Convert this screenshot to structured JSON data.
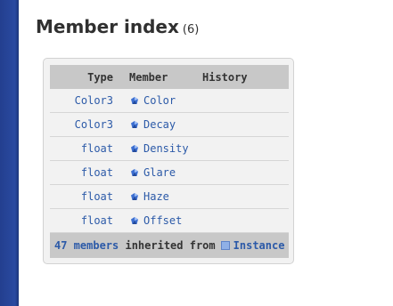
{
  "heading": {
    "title": "Member index",
    "count": "(6)"
  },
  "table": {
    "headers": {
      "type": "Type",
      "member": "Member",
      "history": "History"
    },
    "rows": [
      {
        "type": "Color3",
        "member": "Color"
      },
      {
        "type": "Color3",
        "member": "Decay"
      },
      {
        "type": "float",
        "member": "Density"
      },
      {
        "type": "float",
        "member": "Glare"
      },
      {
        "type": "float",
        "member": "Haze"
      },
      {
        "type": "float",
        "member": "Offset"
      }
    ],
    "footer": {
      "members_link": "47 members",
      "inherited_text": "inherited from",
      "instance_link": "Instance"
    }
  },
  "icons": {
    "member": "property-gem-icon",
    "instance": "instance-class-icon"
  },
  "colors": {
    "link": "#2c5aa8",
    "sidebar": "#2a4aa0",
    "header_bg": "#c8c8c8",
    "panel_bg": "#f2f2f2"
  }
}
